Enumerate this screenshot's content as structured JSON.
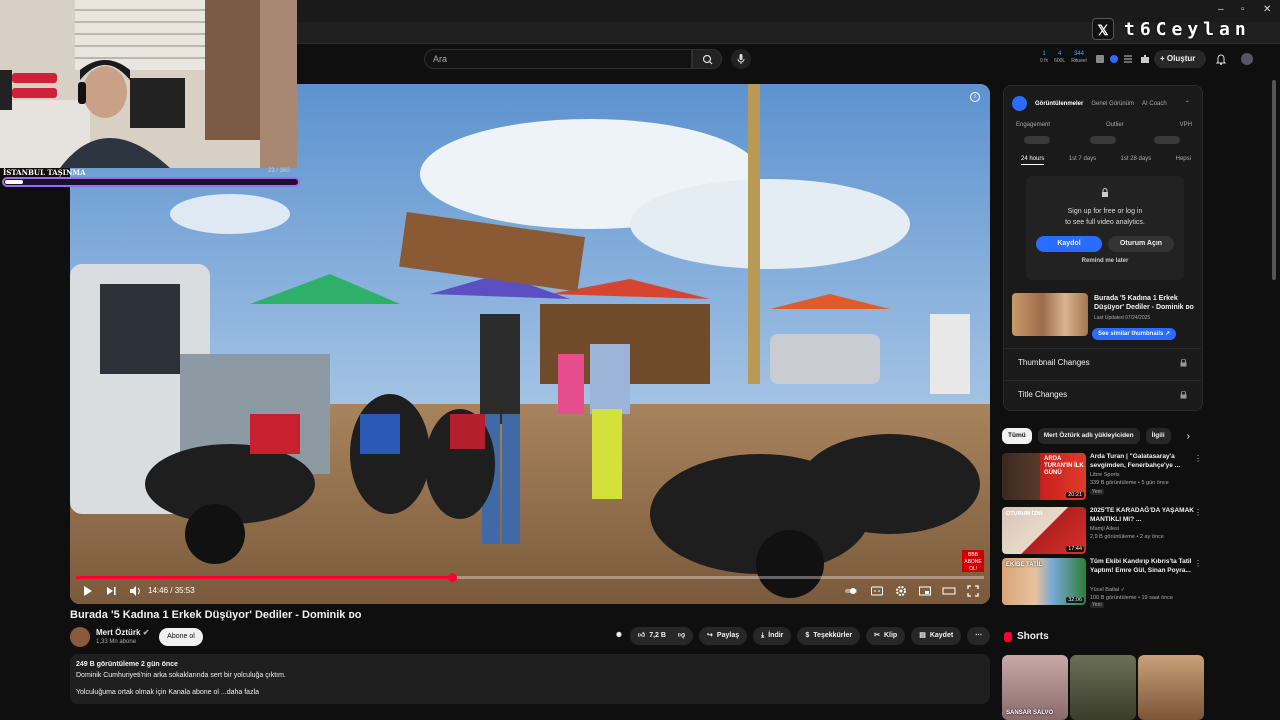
{
  "window": {
    "minimize": "–",
    "maximize": "▫",
    "close": "✕"
  },
  "brand": {
    "x_logo": "𝕏",
    "handle": "t6Ceylan"
  },
  "header": {
    "search_placeholder": "Ara",
    "stats": [
      {
        "value": "1",
        "label": "0 fx"
      },
      {
        "value": "4",
        "label": "600L"
      },
      {
        "value": "344",
        "label": "Ritueel"
      }
    ],
    "create_label": "Oluştur"
  },
  "webcam": {
    "label": "İSTANBUL TAŞINMA",
    "count": "23 / 360",
    "progress_fraction": 0.06
  },
  "player": {
    "time": "14:46 / 35:53",
    "progress_fraction": 0.414,
    "badge": "BBB ABONE OL!"
  },
  "video": {
    "title": "Burada '5 Kadına 1 Erkek Düşüyor' Dediler - Dominik ᴅᴏ",
    "channel": "Mert Öztürk",
    "subscribers": "1,33 Mn abone",
    "subscribe_label": "Abone ol",
    "likes": "7,2 B",
    "actions": {
      "share": "Paylaş",
      "download": "İndir",
      "thanks": "Teşekkürler",
      "clip": "Klip",
      "save": "Kaydet"
    },
    "desc_stats": "249 B görüntüleme  2 gün önce",
    "desc_line1": "Dominik Cumhuriyeti'nin arka sokaklarında sert bir yolculuğa çıktım.",
    "desc_line2": "Yolculuğuma ortak olmak için Kanala abone ol ...daha fazla"
  },
  "panel": {
    "tabs": [
      "Görüntülenmeler",
      "Genel Görünüm",
      "AI Coach"
    ],
    "metrics": [
      "Engagement",
      "Outlier",
      "VPH"
    ],
    "ranges": [
      "24 hours",
      "1st 7 days",
      "1st 28 days",
      "Hepsi"
    ],
    "signup_line1": "Sign up for free or log in",
    "signup_line2": "to see full video analytics.",
    "register": "Kaydol",
    "login": "Oturum Açın",
    "remind": "Remind me later",
    "video_title": "Burada '5 Kadına 1 Erkek Düşüyor' Dediler - Dominik ᴅᴏ",
    "updated": "Last Updated 07/24/2025",
    "similar": "See similar thumbnails ↗",
    "rows": [
      "Thumbnail Changes",
      "Title Changes"
    ]
  },
  "chips": [
    "Tümü",
    "Mert Öztürk adlı yükleyiciden",
    "İlgili"
  ],
  "recommendations": [
    {
      "title": "Arda Turan | \"Galatasaray'a sevgimden, Fenerbahçe'ye ...",
      "channel": "Libre Sports",
      "meta": "339 B görüntüleme • 5 gün önce",
      "duration": "20:21",
      "tag": "Yeni",
      "thumb_text": "ARDA TURAN'IN İLK GÜNÜ"
    },
    {
      "title": "2025'TE KARADAĞ'DA YAŞAMAK MANTIKLI MI? ...",
      "channel": "Mamjl Ailesi",
      "meta": "2,9 B görüntüleme • 2 ay önce",
      "duration": "17:44",
      "tag": "",
      "thumb_text": "OTURUM İZNİ"
    },
    {
      "title": "Tüm Ekibi Kandırıp Kıbrıs'ta Tatil Yaptım! Emre Gül, Sinan Poyra...",
      "channel": "Yücel Batlal ✓",
      "meta": "100 B görüntüleme • 19 saat önce",
      "duration": "32:06",
      "tag": "Yeni",
      "thumb_text": "EKİBE TATİL"
    }
  ],
  "shorts": {
    "heading": "Shorts",
    "items": [
      "SANSAR SALVO",
      "",
      ""
    ]
  }
}
